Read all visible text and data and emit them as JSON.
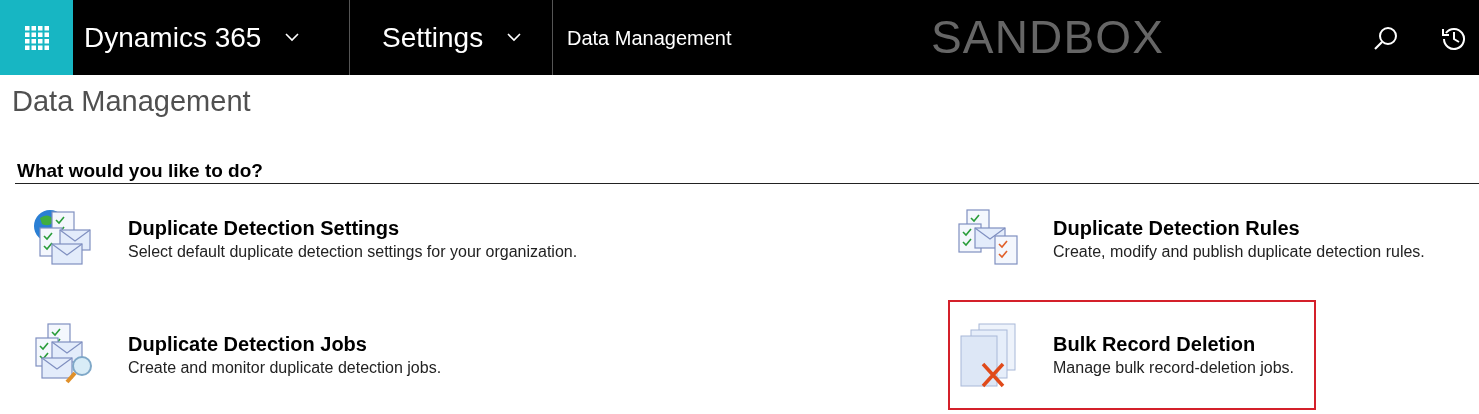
{
  "top_bar": {
    "app_name": "Dynamics 365",
    "area": "Settings",
    "page": "Data Management",
    "environment": "SANDBOX"
  },
  "page_title": "Data Management",
  "section": {
    "heading": "What would you like to do?"
  },
  "options": [
    {
      "kind": "settings",
      "title": "Duplicate Detection Settings",
      "description": "Select default duplicate detection settings for your organization.",
      "highlighted": false
    },
    {
      "kind": "rules",
      "title": "Duplicate Detection Rules",
      "description": "Create, modify and publish duplicate detection rules.",
      "highlighted": false
    },
    {
      "kind": "jobs",
      "title": "Duplicate Detection Jobs",
      "description": "Create and monitor duplicate detection jobs.",
      "highlighted": false
    },
    {
      "kind": "deletion",
      "title": "Bulk Record Deletion",
      "description": "Manage bulk record-deletion jobs.",
      "highlighted": true
    }
  ]
}
